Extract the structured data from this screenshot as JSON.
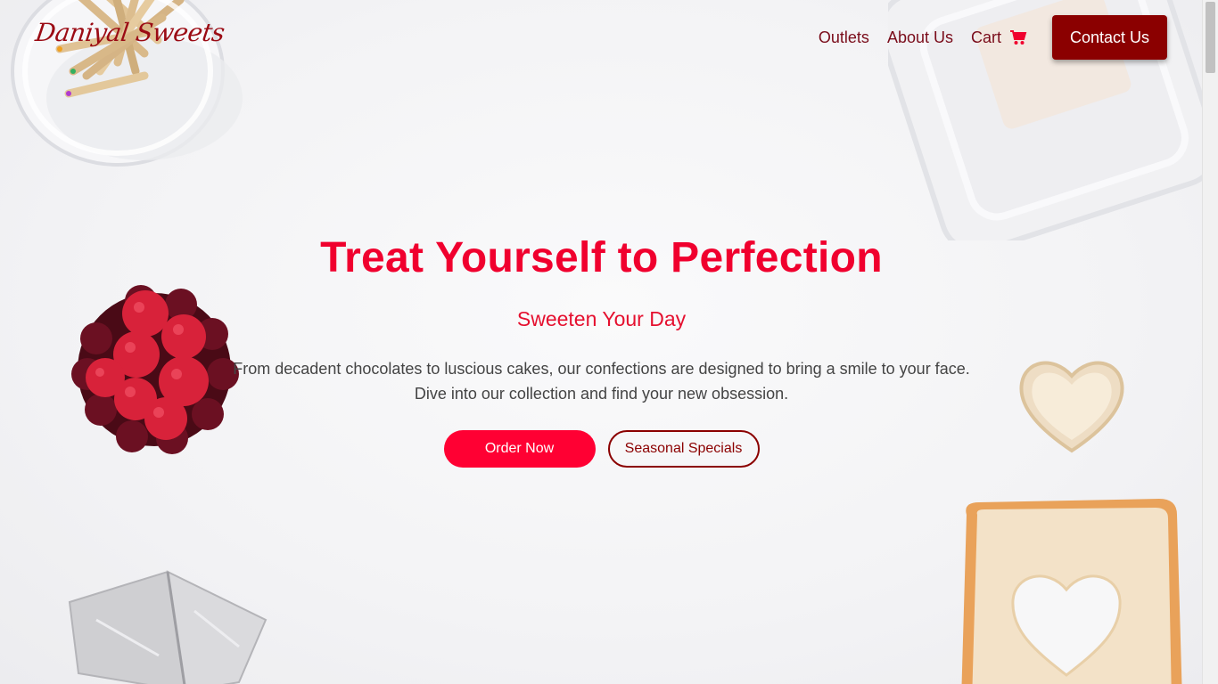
{
  "brand": {
    "logo_text": "Daniyal Sweets",
    "primary_color": "#ff0033",
    "dark_accent": "#8b0000"
  },
  "nav": {
    "items": [
      {
        "label": "Outlets"
      },
      {
        "label": "About Us"
      },
      {
        "label": "Cart",
        "icon": "cart-icon"
      }
    ],
    "contact_label": "Contact Us"
  },
  "hero": {
    "title": "Treat Yourself to Perfection",
    "subtitle": "Sweeten Your Day",
    "description_line1": "From decadent chocolates to luscious cakes, our confections are designed to bring a smile to your face.",
    "description_line2": "Dive into our collection and find your new obsession.",
    "primary_cta": "Order Now",
    "secondary_cta": "Seasonal Specials"
  },
  "decor": {
    "images": [
      "pencil-jar",
      "plastic-container",
      "raspberry-tart",
      "bread-heart",
      "toast-heart-cutout",
      "foil-wrapped-cheese"
    ]
  }
}
